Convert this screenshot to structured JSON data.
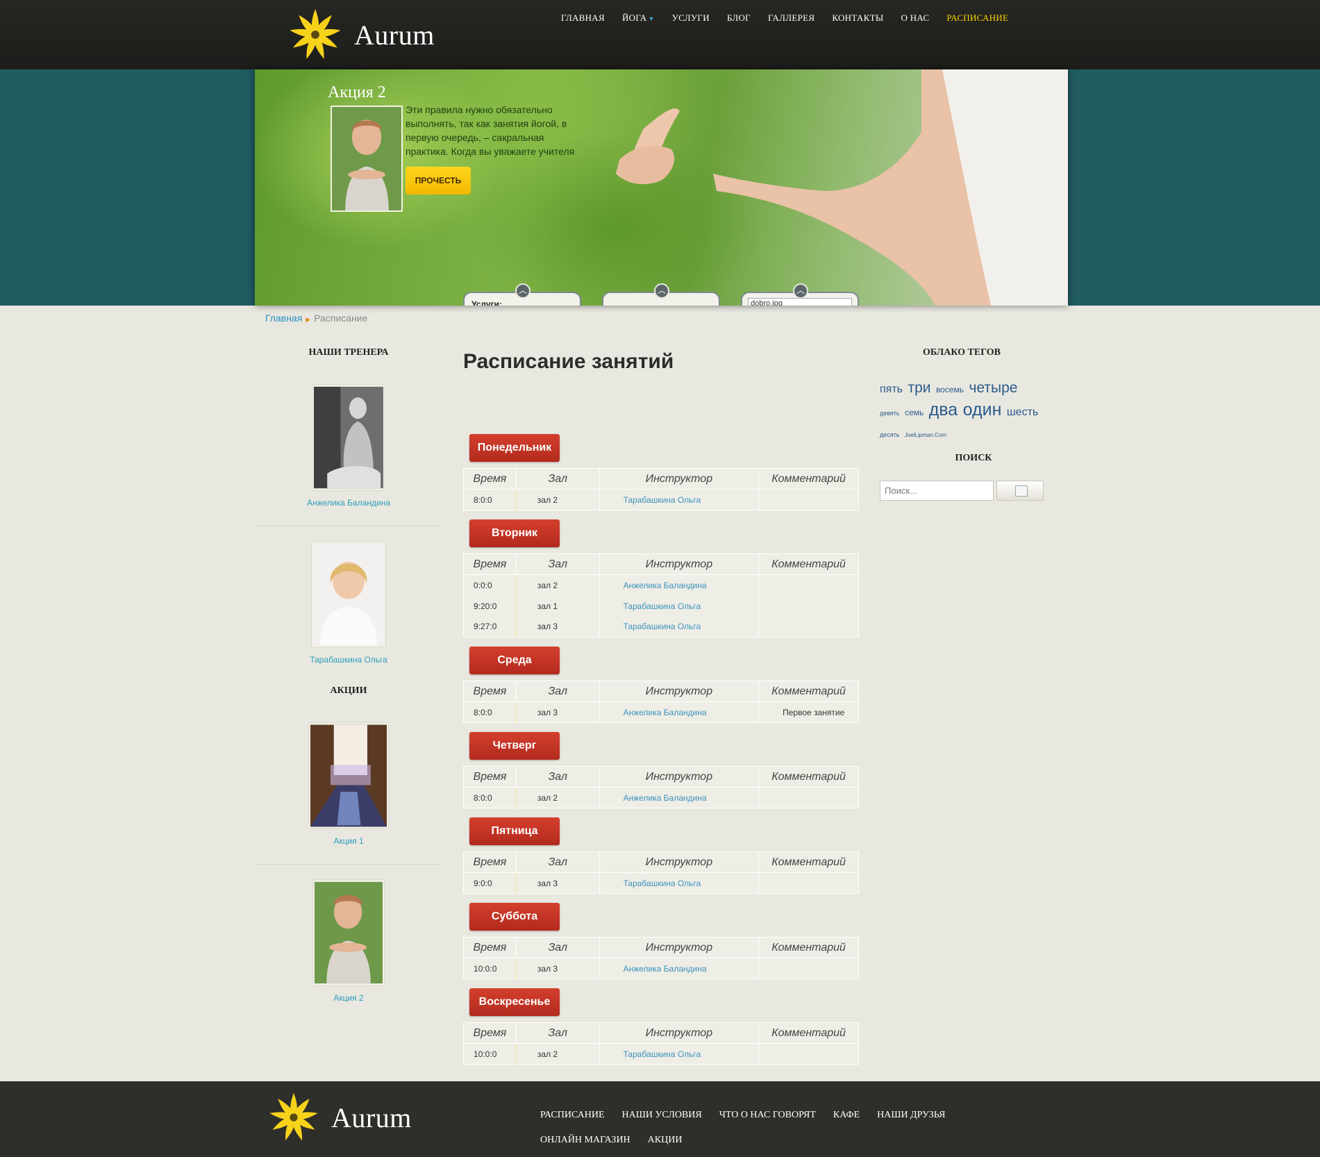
{
  "brand": {
    "name": "Aurum"
  },
  "nav": {
    "items": [
      {
        "label": "ГЛАВНАЯ"
      },
      {
        "label": "ЙОГА"
      },
      {
        "label": "УСЛУГИ"
      },
      {
        "label": "БЛОГ"
      },
      {
        "label": "ГАЛЛЕРЕЯ"
      },
      {
        "label": "КОНТАКТЫ"
      },
      {
        "label": "О НАС"
      },
      {
        "label": "РАСПИСАНИЕ"
      }
    ],
    "active": "РАСПИСАНИЕ",
    "accent_color": "#f7d600"
  },
  "hero": {
    "title": "Акция 2",
    "text": "Эти правила нужно обязательно выполнять, так как занятия йогой, в первую очередь, – сакральная практика. Когда вы уважаете учителя",
    "button": "ПРОЧЕСТЬ",
    "tabs": [
      {
        "label": "Услуги:",
        "input": ""
      },
      {
        "label": "",
        "input": ""
      },
      {
        "label": "",
        "input": "dobro.jpg"
      }
    ]
  },
  "breadcrumb": {
    "home": "Главная",
    "current": "Расписание"
  },
  "sidebar": {
    "trainers_heading": "НАШИ ТРЕНЕРА",
    "trainers": [
      {
        "name": "Анжелика Баландина"
      },
      {
        "name": "Тарабашкина Ольга"
      }
    ],
    "promos_heading": "АКЦИИ",
    "promos": [
      {
        "name": "Акция 1"
      },
      {
        "name": "Акция 2"
      }
    ]
  },
  "main": {
    "title": "Расписание занятий",
    "columns": [
      "Время",
      "Зал",
      "Инструктор",
      "Комментарий"
    ],
    "days": [
      {
        "name": "Понедельник",
        "rows": [
          {
            "time": "8:0:0",
            "hall": "зал 2",
            "instructor": "Тарабашкина Ольга",
            "comment": ""
          }
        ]
      },
      {
        "name": "Вторник",
        "rows": [
          {
            "time": "0:0:0",
            "hall": "зал 2",
            "instructor": "Анжелика Баландина",
            "comment": ""
          },
          {
            "time": "9:20:0",
            "hall": "зал 1",
            "instructor": "Тарабашкина Ольга",
            "comment": ""
          },
          {
            "time": "9:27:0",
            "hall": "зал 3",
            "instructor": "Тарабашкина Ольга",
            "comment": ""
          }
        ]
      },
      {
        "name": "Среда",
        "rows": [
          {
            "time": "8:0:0",
            "hall": "зал 3",
            "instructor": "Анжелика Баландина",
            "comment": "Первое занятие"
          }
        ]
      },
      {
        "name": "Четверг",
        "rows": [
          {
            "time": "8:0:0",
            "hall": "зал 2",
            "instructor": "Анжелика Баландина",
            "comment": ""
          }
        ]
      },
      {
        "name": "Пятница",
        "rows": [
          {
            "time": "9:0:0",
            "hall": "зал 3",
            "instructor": "Тарабашкина Ольга",
            "comment": ""
          }
        ]
      },
      {
        "name": "Суббота",
        "rows": [
          {
            "time": "10:0:0",
            "hall": "зал 3",
            "instructor": "Анжелика Баландина",
            "comment": ""
          }
        ]
      },
      {
        "name": "Воскресенье",
        "rows": [
          {
            "time": "10:0:0",
            "hall": "зал 2",
            "instructor": "Тарабашкина Ольга",
            "comment": ""
          }
        ]
      }
    ]
  },
  "right": {
    "cloud_heading": "ОБЛАКО ТЕГОВ",
    "tags": [
      {
        "text": "пять",
        "size": "m"
      },
      {
        "text": "три",
        "size": "l"
      },
      {
        "text": "восемь",
        "size": "s"
      },
      {
        "text": "четыре",
        "size": "l"
      },
      {
        "text": "девять",
        "size": "xs"
      },
      {
        "text": "семь",
        "size": "s"
      },
      {
        "text": "два",
        "size": "xl"
      },
      {
        "text": "один",
        "size": "xl"
      },
      {
        "text": "шесть",
        "size": "m"
      },
      {
        "text": "десять",
        "size": "xs"
      },
      {
        "text": "JoelLipman.Com",
        "size": "xxs"
      }
    ],
    "search_heading": "ПОИСК",
    "search_placeholder": "Поиск..."
  },
  "footer": {
    "links": [
      "РАСПИСАНИЕ",
      "НАШИ УСЛОВИЯ",
      "ЧТО О НАС ГОВОРЯТ",
      "КАФЕ",
      "НАШИ ДРУЗЬЯ",
      "ОНЛАЙН МАГАЗИН",
      "АКЦИИ"
    ]
  },
  "colors": {
    "header_bg": "#1d1d1b",
    "hero_band": "#205c62",
    "day_button": "#c2321f",
    "link": "#3b94bd",
    "cta": "#ffd71e"
  }
}
